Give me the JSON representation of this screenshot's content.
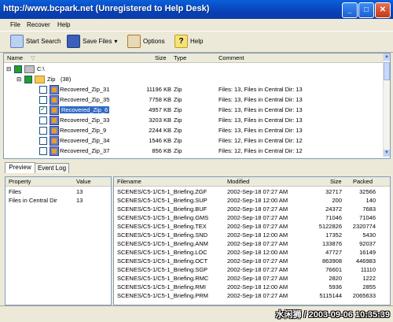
{
  "window": {
    "title": "http://www.bcpark.net (Unregistered to Help Desk)",
    "url_part": "http://www.bcpark.net",
    "title_rest": "gistered to Help Desk)"
  },
  "menu": [
    "File",
    "Recover",
    "Help"
  ],
  "toolbar": {
    "start_search": "Start Search",
    "save_files": "Save Files",
    "options": "Options",
    "help": "Help"
  },
  "tree": {
    "columns": {
      "name": "Name",
      "size": "Size",
      "type": "Type",
      "comment": "Comment"
    },
    "drive": "C:\\",
    "zip_group": "Zip",
    "zip_count": "(38)",
    "rows": [
      {
        "name": "Recovered_Zip_31",
        "size": "11196 KB",
        "type": "Zip",
        "comment": "Files: 13, Files in Central Dir: 13"
      },
      {
        "name": "Recovered_Zip_35",
        "size": "7758 KB",
        "type": "Zip",
        "comment": "Files: 13, Files in Central Dir: 13"
      },
      {
        "name": "Recovered_Zip_6",
        "size": "4957 KB",
        "type": "Zip",
        "comment": "Files: 13, Files in Central Dir: 13",
        "checked": true,
        "selected": true
      },
      {
        "name": "Recovered_Zip_33",
        "size": "3203 KB",
        "type": "Zip",
        "comment": "Files: 13, Files in Central Dir: 13"
      },
      {
        "name": "Recovered_Zip_9",
        "size": "2244 KB",
        "type": "Zip",
        "comment": "Files: 13, Files in Central Dir: 13"
      },
      {
        "name": "Recovered_Zip_34",
        "size": "1546 KB",
        "type": "Zip",
        "comment": "Files: 12, Files in Central Dir: 12"
      },
      {
        "name": "Recovered_Zip_37",
        "size": "856 KB",
        "type": "Zip",
        "comment": "Files: 12, Files in Central Dir: 12"
      }
    ]
  },
  "tabs": {
    "preview": "Preview",
    "event_log": "Event Log"
  },
  "properties": {
    "columns": {
      "property": "Property",
      "value": "Value"
    },
    "rows": [
      {
        "property": "Files",
        "value": "13"
      },
      {
        "property": "Files in Central Dir",
        "value": "13"
      }
    ]
  },
  "files": {
    "columns": {
      "filename": "Filename",
      "modified": "Modified",
      "size": "Size",
      "packed": "Packed"
    },
    "rows": [
      {
        "filename": "SCENES/C5-1/C5-1_Briefing.ZGF",
        "modified": "2002-Sep-18  07:27 AM",
        "size": "32717",
        "packed": "32566"
      },
      {
        "filename": "SCENES/C5-1/C5-1_Briefing.SUP",
        "modified": "2002-Sep-18  12:00 AM",
        "size": "200",
        "packed": "140"
      },
      {
        "filename": "SCENES/C5-1/C5-1_Briefing.BUF",
        "modified": "2002-Sep-18  07:27 AM",
        "size": "24372",
        "packed": "7683"
      },
      {
        "filename": "SCENES/C5-1/C5-1_Briefing.GMS",
        "modified": "2002-Sep-18  07:27 AM",
        "size": "71046",
        "packed": "71046"
      },
      {
        "filename": "SCENES/C5-1/C5-1_Briefing.TEX",
        "modified": "2002-Sep-18  07:27 AM",
        "size": "5122826",
        "packed": "2320774"
      },
      {
        "filename": "SCENES/C5-1/C5-1_Briefing.SND",
        "modified": "2002-Sep-18  12:00 AM",
        "size": "17352",
        "packed": "5430"
      },
      {
        "filename": "SCENES/C5-1/C5-1_Briefing.ANM",
        "modified": "2002-Sep-18  07:27 AM",
        "size": "133876",
        "packed": "92037"
      },
      {
        "filename": "SCENES/C5-1/C5-1_Briefing.LOC",
        "modified": "2002-Sep-18  12:00 AM",
        "size": "47727",
        "packed": "16149"
      },
      {
        "filename": "SCENES/C5-1/C5-1_Briefing.OCT",
        "modified": "2002-Sep-18  07:27 AM",
        "size": "863908",
        "packed": "446983"
      },
      {
        "filename": "SCENES/C5-1/C5-1_Briefing.SGP",
        "modified": "2002-Sep-18  07:27 AM",
        "size": "76601",
        "packed": "11110"
      },
      {
        "filename": "SCENES/C5-1/C5-1_Briefing.RMC",
        "modified": "2002-Sep-18  07:27 AM",
        "size": "2820",
        "packed": "1222"
      },
      {
        "filename": "SCENES/C5-1/C5-1_Briefing.RMI",
        "modified": "2002-Sep-18  12:00 AM",
        "size": "5936",
        "packed": "2855"
      },
      {
        "filename": "SCENES/C5-1/C5-1_Briefing.PRM",
        "modified": "2002-Sep-18  07:27 AM",
        "size": "5115144",
        "packed": "2065633"
      }
    ]
  },
  "watermark": "水闲狮 / 2003-09-06 10:35:39",
  "colors": {
    "titlebar": "#0842b8",
    "selection": "#316ac5",
    "window_bg": "#ece9d8"
  }
}
